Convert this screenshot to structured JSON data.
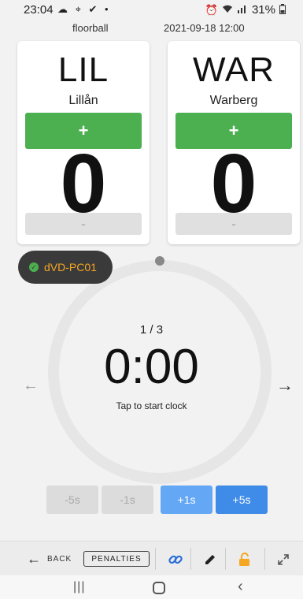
{
  "status_bar": {
    "time": "23:04",
    "left_icons": "☁ ⌖ ✔ •",
    "battery": "31%"
  },
  "game": {
    "sport": "floorball",
    "datetime": "2021-09-18 12:00"
  },
  "home_team": {
    "abbr": "LIL",
    "name": "Lillån",
    "score": "0",
    "plus_label": "+",
    "minus_label": "-"
  },
  "away_team": {
    "abbr": "WAR",
    "name": "Warberg",
    "score": "0",
    "plus_label": "+",
    "minus_label": "-"
  },
  "device": {
    "label": "dVD-PC01",
    "status": "connected"
  },
  "clock": {
    "period": "1 / 3",
    "time": "0:00",
    "hint": "Tap to start clock"
  },
  "adjust_buttons": {
    "minus5": "-5s",
    "minus1": "-1s",
    "plus1": "+1s",
    "plus5": "+5s"
  },
  "toolbar": {
    "back_label": "BACK",
    "penalties_label": "PENALTIES",
    "icons": [
      "link-icon",
      "edit-icon",
      "lock-open-icon",
      "expand-icon"
    ]
  },
  "colors": {
    "green": "#4caf50",
    "blue": "#3f8be8",
    "light_blue": "#64a8f5",
    "device_orange": "#f5a623",
    "lock_orange": "#f5a623",
    "link_blue": "#2a6ed8"
  }
}
